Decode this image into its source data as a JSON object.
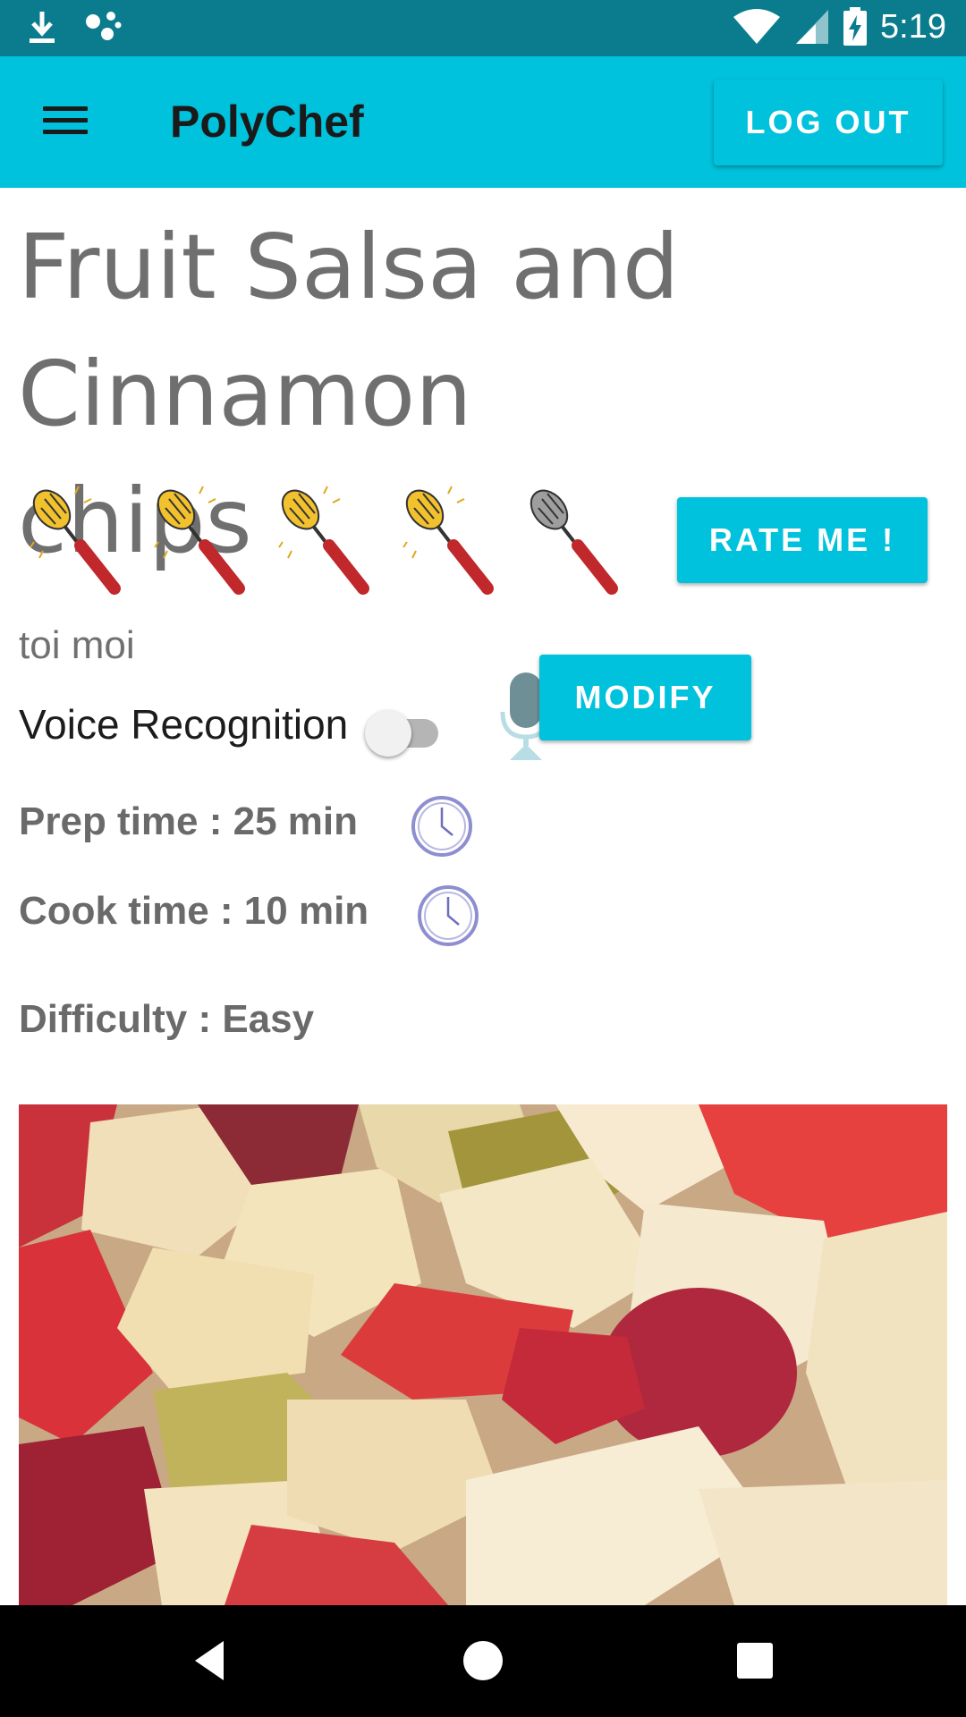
{
  "status_bar": {
    "time": "5:19",
    "icons": [
      "download-icon",
      "assistant-icon",
      "wifi-icon",
      "signal-icon",
      "battery-charging-icon"
    ]
  },
  "app_bar": {
    "title": "PolyChef",
    "logout_label": "LOG OUT",
    "menu_icon": "menu-icon"
  },
  "recipe": {
    "title_line1": "Fruit Salsa and",
    "title_line2": "Cinnamon chips",
    "rating": {
      "value": 4,
      "max": 5
    },
    "rate_label": "RATE ME !",
    "author": "toi moi",
    "voice_label": "Voice Recognition",
    "voice_enabled": false,
    "modify_label": "MODIFY",
    "prep_time": "Prep time : 25 min",
    "cook_time": "Cook time : 10 min",
    "difficulty": "Difficulty : Easy",
    "photo_alt": "fruit-salsa-photo"
  },
  "colors": {
    "status_bar": "#0a7c8e",
    "app_bar": "#00c2dc",
    "accent": "#00c2dc",
    "whisk_active": "#f2c12e",
    "whisk_inactive": "#9e9e9e",
    "handle": "#c0282b"
  },
  "nav_bar": {
    "icons": [
      "back-icon",
      "home-icon",
      "recents-icon"
    ]
  }
}
